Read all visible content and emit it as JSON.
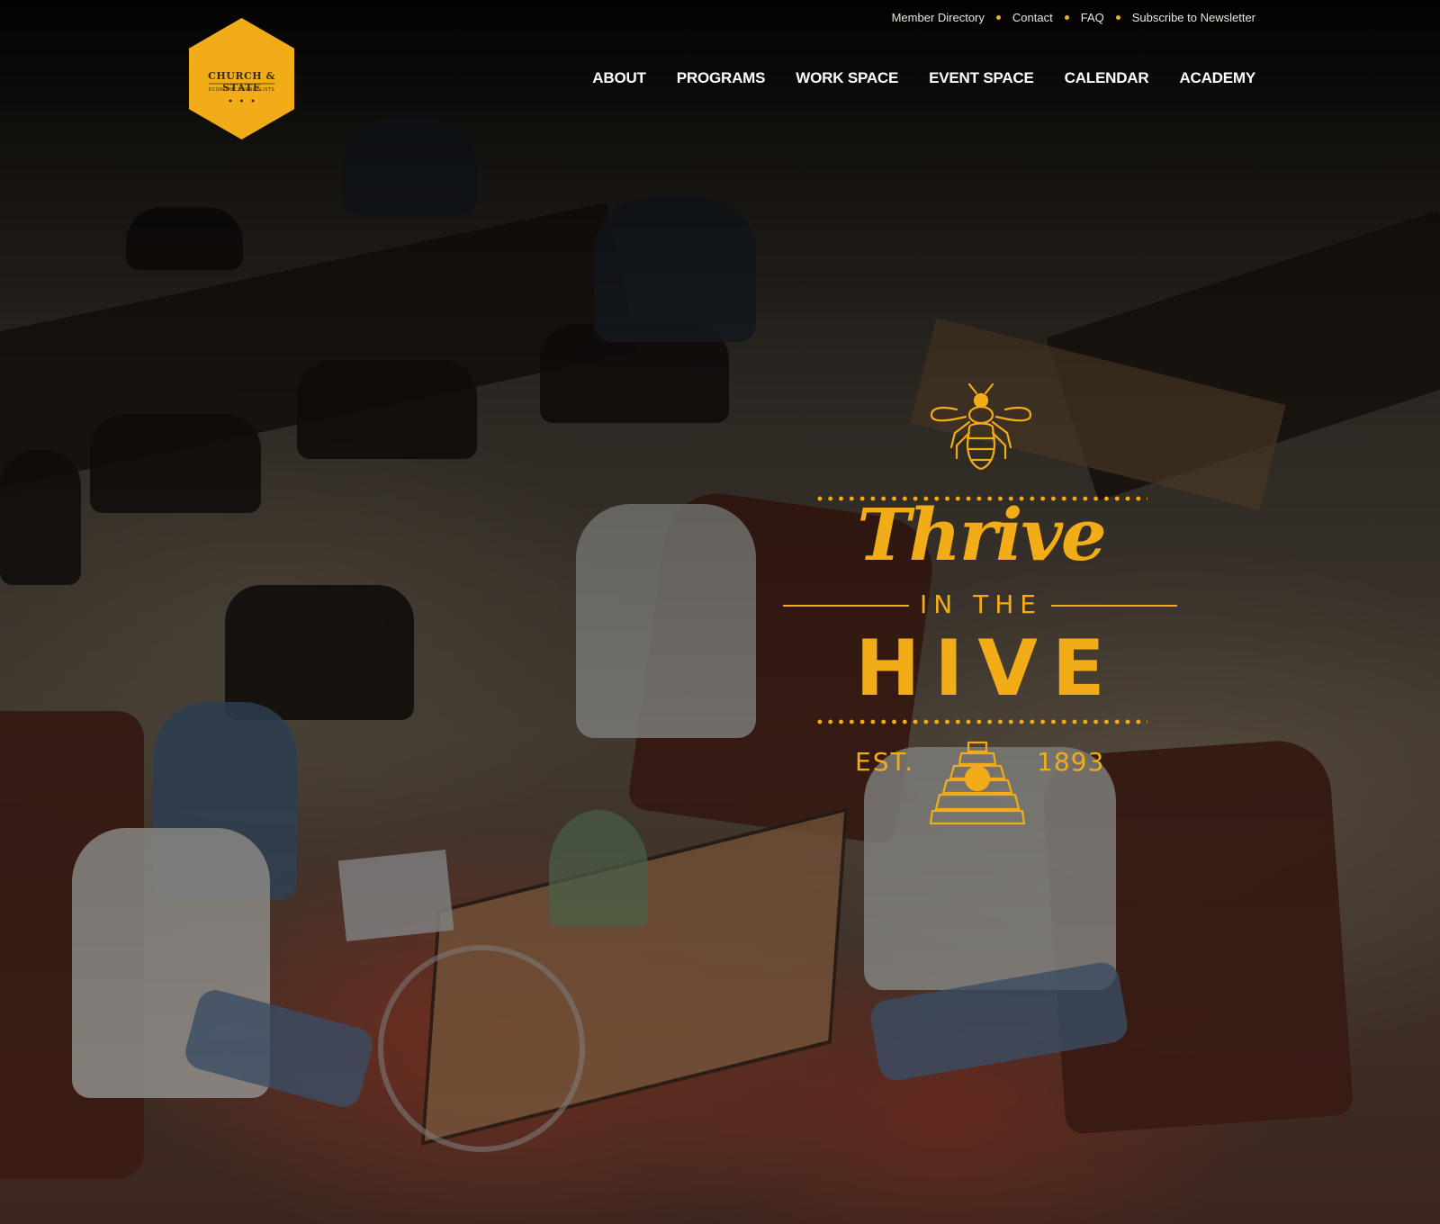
{
  "brand": {
    "logo_name": "CHURCH & STATE",
    "logo_tagline": "ECONOMIC EVANGELISTS",
    "accent_color": "#f2ac18"
  },
  "utility_nav": {
    "items": [
      "Member Directory",
      "Contact",
      "FAQ",
      "Subscribe to Newsletter"
    ]
  },
  "main_nav": {
    "items": [
      "ABOUT",
      "PROGRAMS",
      "WORK SPACE",
      "EVENT SPACE",
      "CALENDAR",
      "ACADEMY"
    ]
  },
  "hero": {
    "headline_script": "Thrive",
    "headline_middle": "IN THE",
    "headline_bold": "HIVE",
    "est_label": "EST.",
    "est_year": "1893",
    "icons": [
      "bee-icon",
      "beehive-skep-icon"
    ]
  }
}
